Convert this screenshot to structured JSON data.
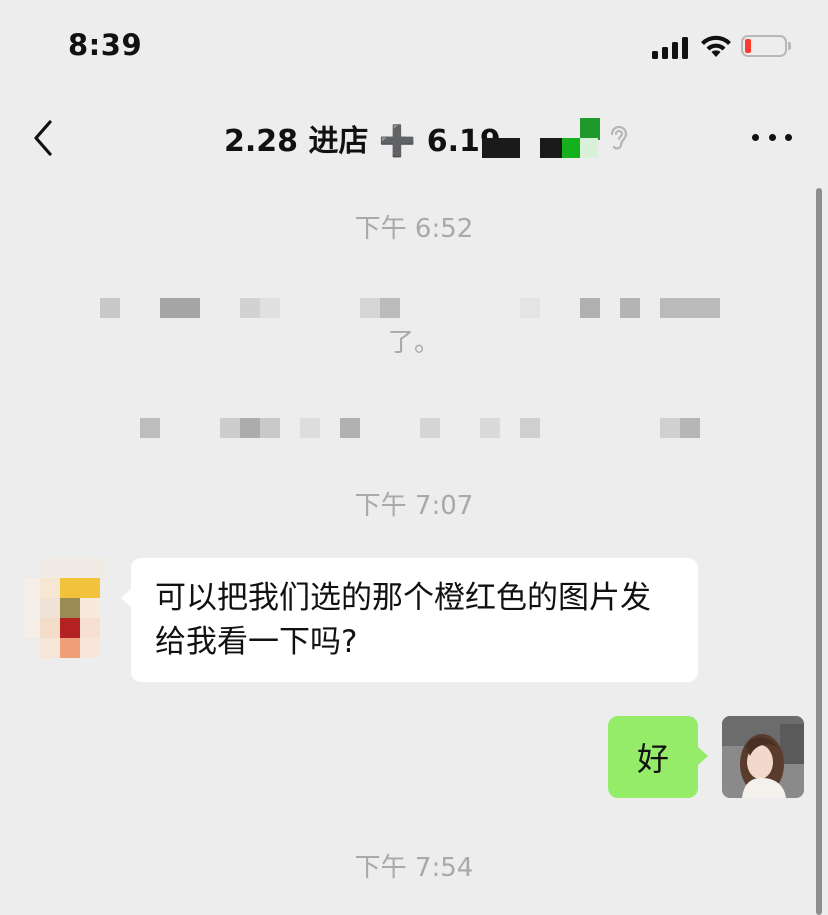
{
  "status_bar": {
    "time": "8:39",
    "battery_color": "#ff3b30"
  },
  "nav": {
    "back_icon": "chevron-left-icon",
    "title": "2.28 进店 ➕ 6.19",
    "ear_icon": "ear-icon",
    "more_icon": "more-dots-icon"
  },
  "messages": {
    "ts_1": "下午 6:52",
    "system_tail": "了。",
    "ts_2": "下午 7:07",
    "incoming_text": "可以把我们选的那个橙红色的图片发给我看一下吗?",
    "outgoing_text": "好",
    "ts_3": "下午 7:54"
  },
  "colors": {
    "outgoing_bubble": "#95ec69",
    "incoming_bubble": "#ffffff",
    "background": "#ededed"
  }
}
